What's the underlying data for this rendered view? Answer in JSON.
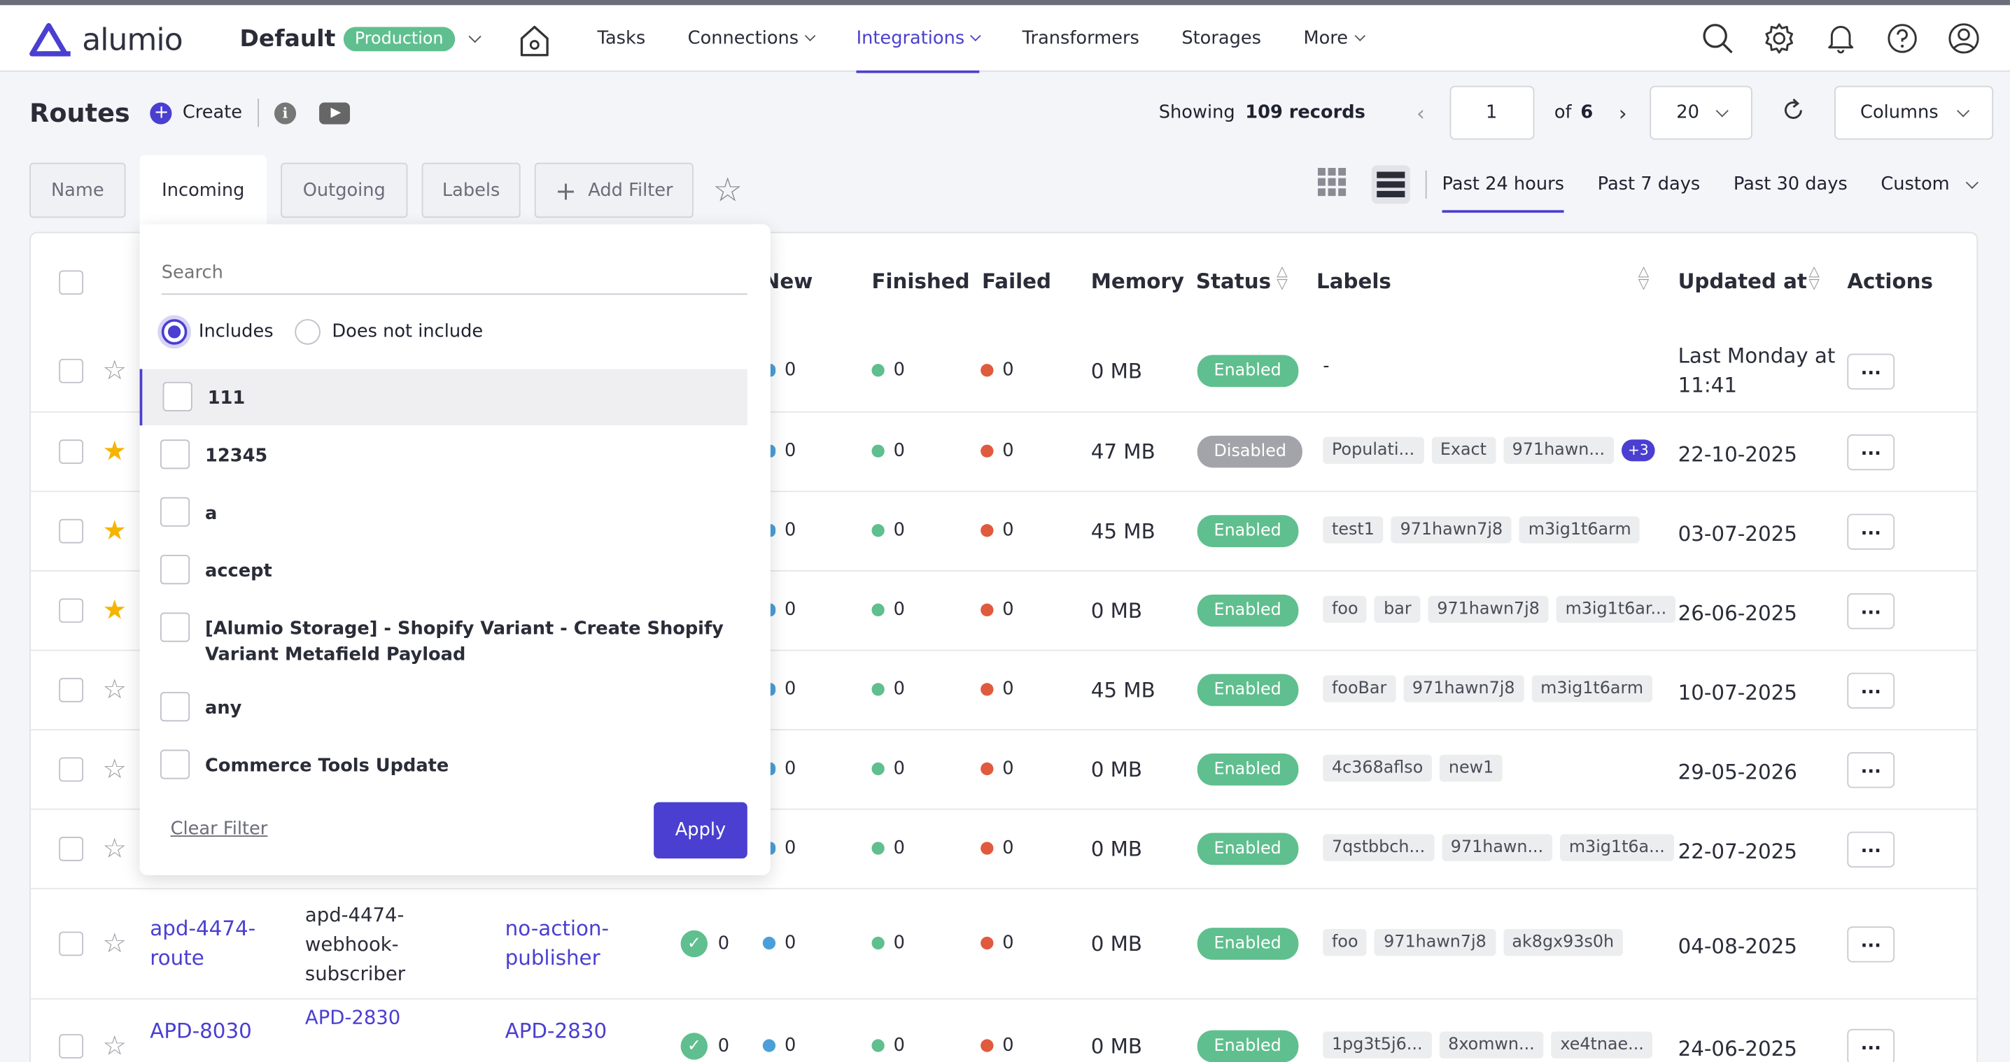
{
  "brand": {
    "logo_text": "alumio",
    "color": "#4a3fd0"
  },
  "env": {
    "name": "Default",
    "badge": "Production"
  },
  "nav": {
    "items": [
      {
        "label": "Tasks",
        "dropdown": false,
        "active": false
      },
      {
        "label": "Connections",
        "dropdown": true,
        "active": false
      },
      {
        "label": "Integrations",
        "dropdown": true,
        "active": true
      },
      {
        "label": "Transformers",
        "dropdown": false,
        "active": false
      },
      {
        "label": "Storages",
        "dropdown": false,
        "active": false
      },
      {
        "label": "More",
        "dropdown": true,
        "active": false
      }
    ]
  },
  "top_icons": [
    "search-icon",
    "gear-icon",
    "bell-icon",
    "help-icon",
    "user-icon"
  ],
  "page": {
    "title": "Routes",
    "create_label": "Create"
  },
  "pager": {
    "showing_label": "Showing",
    "records": "109 records",
    "page": "1",
    "of_label": "of",
    "total_pages": "6",
    "per_page": "20",
    "columns_label": "Columns"
  },
  "filters": {
    "tabs": [
      "Name",
      "Incoming",
      "Outgoing",
      "Labels"
    ],
    "active": "Incoming",
    "add_filter": "Add Filter"
  },
  "ranges": {
    "items": [
      "Past 24 hours",
      "Past 7 days",
      "Past 30 days",
      "Custom"
    ],
    "active": "Past 24 hours"
  },
  "table": {
    "headers": {
      "new": "New",
      "finished": "Finished",
      "failed": "Failed",
      "memory": "Memory",
      "status": "Status",
      "labels": "Labels",
      "updated": "Updated at",
      "actions": "Actions"
    },
    "rows": [
      {
        "name": "",
        "incoming": "",
        "outgoing": "",
        "starred": false,
        "check": "",
        "new": "0",
        "finished": "0",
        "failed": "0",
        "memory": "0 MB",
        "status": "Enabled",
        "labels": [
          "-"
        ],
        "extra": "",
        "updated": "Last Monday at 11:41"
      },
      {
        "name": "",
        "incoming": "",
        "outgoing": "",
        "starred": true,
        "check": "",
        "new": "0",
        "finished": "0",
        "failed": "0",
        "memory": "47 MB",
        "status": "Disabled",
        "labels": [
          "Populati...",
          "Exact",
          "971hawn..."
        ],
        "extra": "+3",
        "updated": "22-10-2025"
      },
      {
        "name": "",
        "incoming": "",
        "outgoing": "",
        "starred": true,
        "check": "",
        "new": "0",
        "finished": "0",
        "failed": "0",
        "memory": "45 MB",
        "status": "Enabled",
        "labels": [
          "test1",
          "971hawn7j8",
          "m3ig1t6arm"
        ],
        "extra": "",
        "updated": "03-07-2025"
      },
      {
        "name": "",
        "incoming": "",
        "outgoing": "",
        "starred": true,
        "check": "",
        "new": "0",
        "finished": "0",
        "failed": "0",
        "memory": "0 MB",
        "status": "Enabled",
        "labels": [
          "foo",
          "bar",
          "971hawn7j8",
          "m3ig1t6ar..."
        ],
        "extra": "",
        "updated": "26-06-2025"
      },
      {
        "name": "",
        "incoming": "",
        "outgoing": "",
        "starred": false,
        "check": "",
        "new": "0",
        "finished": "0",
        "failed": "0",
        "memory": "45 MB",
        "status": "Enabled",
        "labels": [
          "fooBar",
          "971hawn7j8",
          "m3ig1t6arm"
        ],
        "extra": "",
        "updated": "10-07-2025"
      },
      {
        "name": "",
        "incoming": "",
        "outgoing": "",
        "starred": false,
        "check": "",
        "new": "0",
        "finished": "0",
        "failed": "0",
        "memory": "0 MB",
        "status": "Enabled",
        "labels": [
          "4c368aflso",
          "new1"
        ],
        "extra": "",
        "updated": "29-05-2026"
      },
      {
        "name": "",
        "incoming": "",
        "outgoing": "",
        "starred": false,
        "check": "",
        "new": "0",
        "finished": "0",
        "failed": "0",
        "memory": "0 MB",
        "status": "Enabled",
        "labels": [
          "7qstbbch...",
          "971hawn...",
          "m3ig1t6a..."
        ],
        "extra": "",
        "updated": "22-07-2025"
      },
      {
        "name": "apd-4474-route",
        "incoming": "apd-4474-webhook-subscriber",
        "outgoing": "no-action-publisher",
        "starred": false,
        "check": "0",
        "new": "0",
        "finished": "0",
        "failed": "0",
        "memory": "0 MB",
        "status": "Enabled",
        "labels": [
          "foo",
          "971hawn7j8",
          "ak8gx93s0h"
        ],
        "extra": "",
        "updated": "04-08-2025"
      },
      {
        "name": "APD-8030",
        "incoming": "APD-2830",
        "outgoing": "APD-2830",
        "starred": false,
        "check": "0",
        "new": "0",
        "finished": "0",
        "failed": "0",
        "memory": "0 MB",
        "status": "Enabled",
        "labels": [
          "1pg3t5j6...",
          "8xomwn...",
          "xe4tnae..."
        ],
        "extra": "",
        "updated": "24-06-2025"
      }
    ],
    "actions_label": "..."
  },
  "dropdown": {
    "search_placeholder": "Search",
    "includes": "Includes",
    "excludes": "Does not include",
    "options": [
      "111",
      "12345",
      "a",
      "accept",
      "[Alumio Storage] - Shopify Variant - Create Shopify Variant Metafield Payload",
      "any",
      "Commerce Tools Update"
    ],
    "clear": "Clear Filter",
    "apply": "Apply"
  },
  "colors": {
    "enabled": "#5fbf8e",
    "disabled": "#a3a4aa",
    "finished": "#5fbf8e",
    "failed": "#e05a3e",
    "new": "#4a9fd8",
    "star": "#f4b400"
  }
}
